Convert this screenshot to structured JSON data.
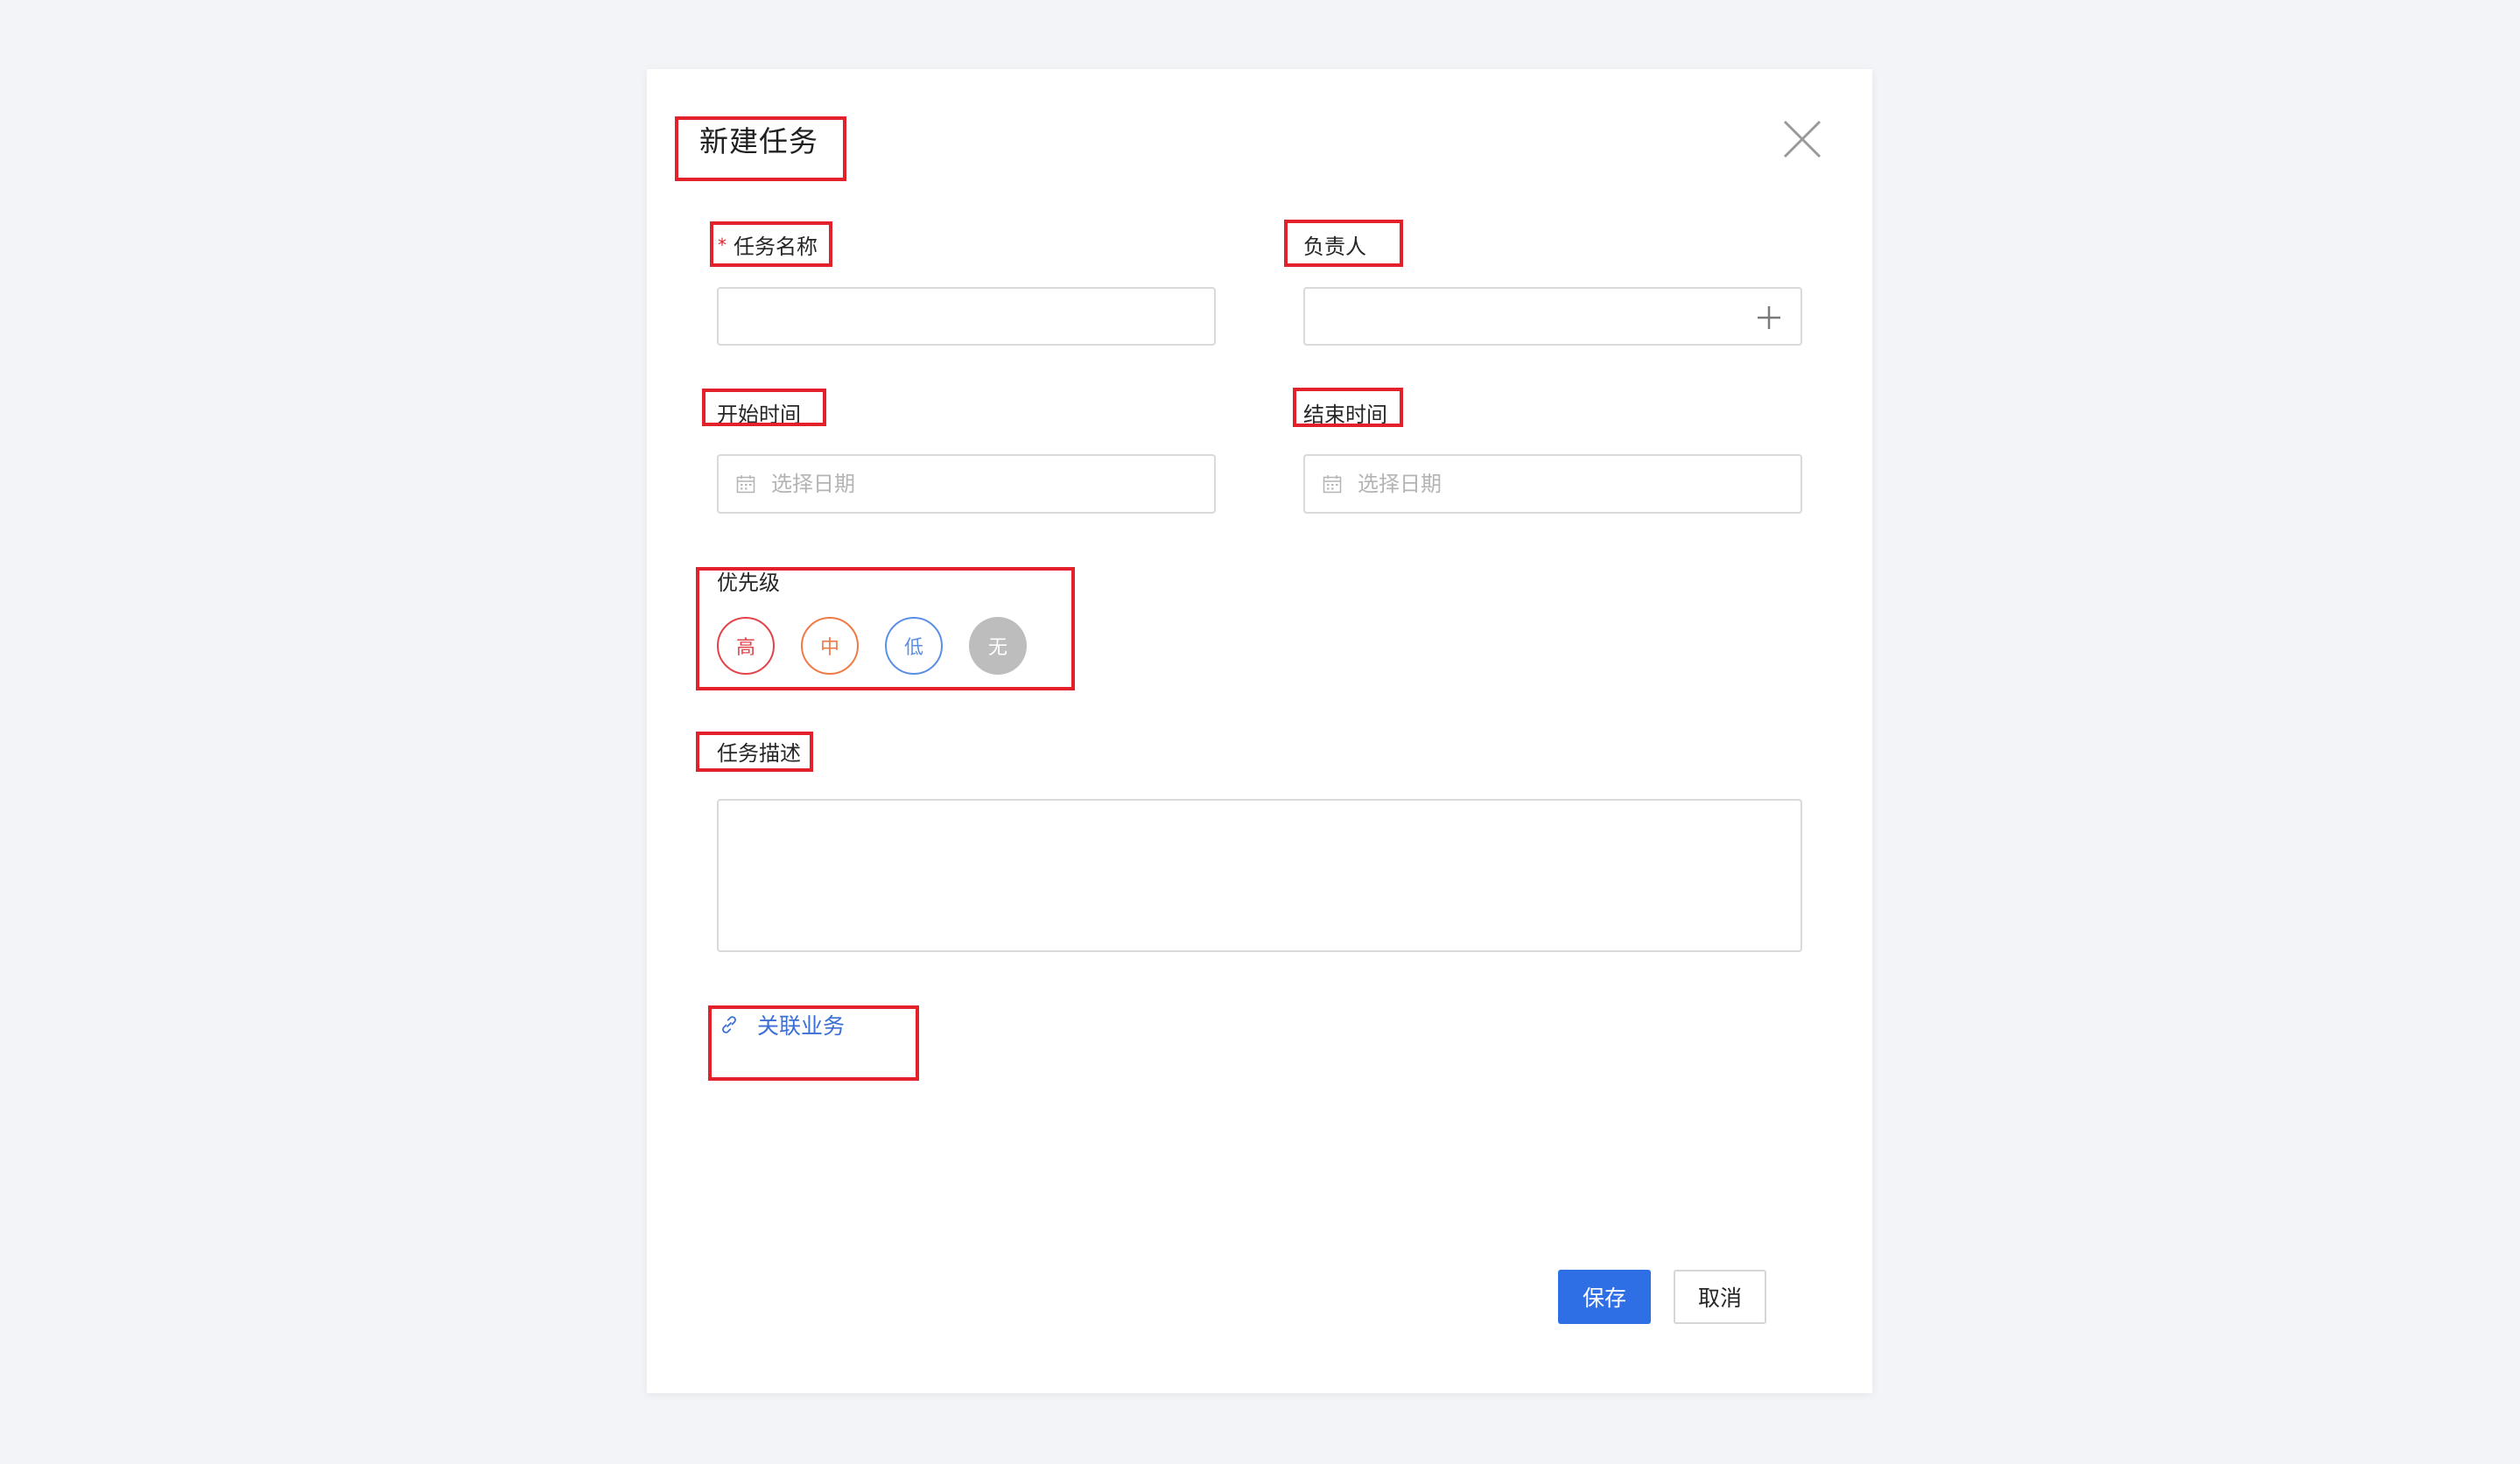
{
  "dialog": {
    "title": "新建任务"
  },
  "form": {
    "task_name": {
      "required_mark": "*",
      "label": "任务名称",
      "value": ""
    },
    "assignee": {
      "label": "负责人",
      "value": ""
    },
    "start_time": {
      "label": "开始时间",
      "placeholder": "选择日期"
    },
    "end_time": {
      "label": "结束时间",
      "placeholder": "选择日期"
    },
    "priority": {
      "label": "优先级",
      "options": [
        {
          "label": "高",
          "color": "#e2444a"
        },
        {
          "label": "中",
          "color": "#f07a46"
        },
        {
          "label": "低",
          "color": "#5b8fe6"
        },
        {
          "label": "无",
          "color": "#bdbdbd"
        }
      ]
    },
    "description": {
      "label": "任务描述",
      "value": ""
    },
    "related_business": {
      "label": "关联业务"
    }
  },
  "footer": {
    "save_label": "保存",
    "cancel_label": "取消"
  },
  "colors": {
    "primary": "#2f6fe6",
    "annotation_red": "#e3212b",
    "link": "#3b6fd6"
  }
}
